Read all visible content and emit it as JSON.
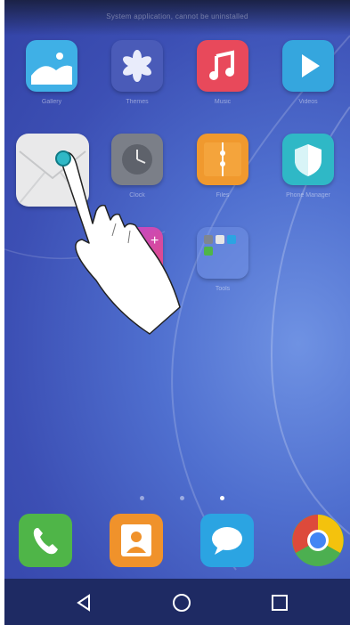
{
  "status_bar": {
    "message": "System application, cannot be uninstalled"
  },
  "home_apps": [
    {
      "name": "Gallery",
      "icon": "gallery-icon",
      "color": "#3fb0e6"
    },
    {
      "name": "Themes",
      "icon": "themes-icon",
      "color": "#4a5bb8"
    },
    {
      "name": "Music",
      "icon": "music-icon",
      "color": "#e8495b"
    },
    {
      "name": "Videos",
      "icon": "video-icon",
      "color": "#35a6de"
    },
    {
      "name": "Email",
      "icon": "email-icon",
      "color": "#e9e9ea"
    },
    {
      "name": "Clock",
      "icon": "clock-icon",
      "color": "#7b7f88"
    },
    {
      "name": "Files",
      "icon": "files-icon",
      "color": "#f0992e"
    },
    {
      "name": "Phone Manager",
      "icon": "shield-icon",
      "color": "#2fb8c6"
    },
    {
      "name": "",
      "icon": "plus-app-icon",
      "color": "#d94a8c"
    },
    {
      "name": "Tools",
      "icon": "folder-icon",
      "color": "#5b76cc"
    }
  ],
  "page_indicator": {
    "count": 3,
    "active": 3
  },
  "dock": [
    {
      "name": "Phone",
      "icon": "phone-icon",
      "color": "#4fb548"
    },
    {
      "name": "Contacts",
      "icon": "contacts-icon",
      "color": "#f0922b"
    },
    {
      "name": "Messaging",
      "icon": "message-icon",
      "color": "#2ba4e2"
    },
    {
      "name": "Chrome",
      "icon": "chrome-icon",
      "color": "#dd4a3b"
    }
  ],
  "nav": [
    {
      "name": "back",
      "icon": "back-icon"
    },
    {
      "name": "home",
      "icon": "home-icon"
    },
    {
      "name": "recents",
      "icon": "recents-icon"
    }
  ],
  "gesture": {
    "type": "tap",
    "target": "Email"
  }
}
